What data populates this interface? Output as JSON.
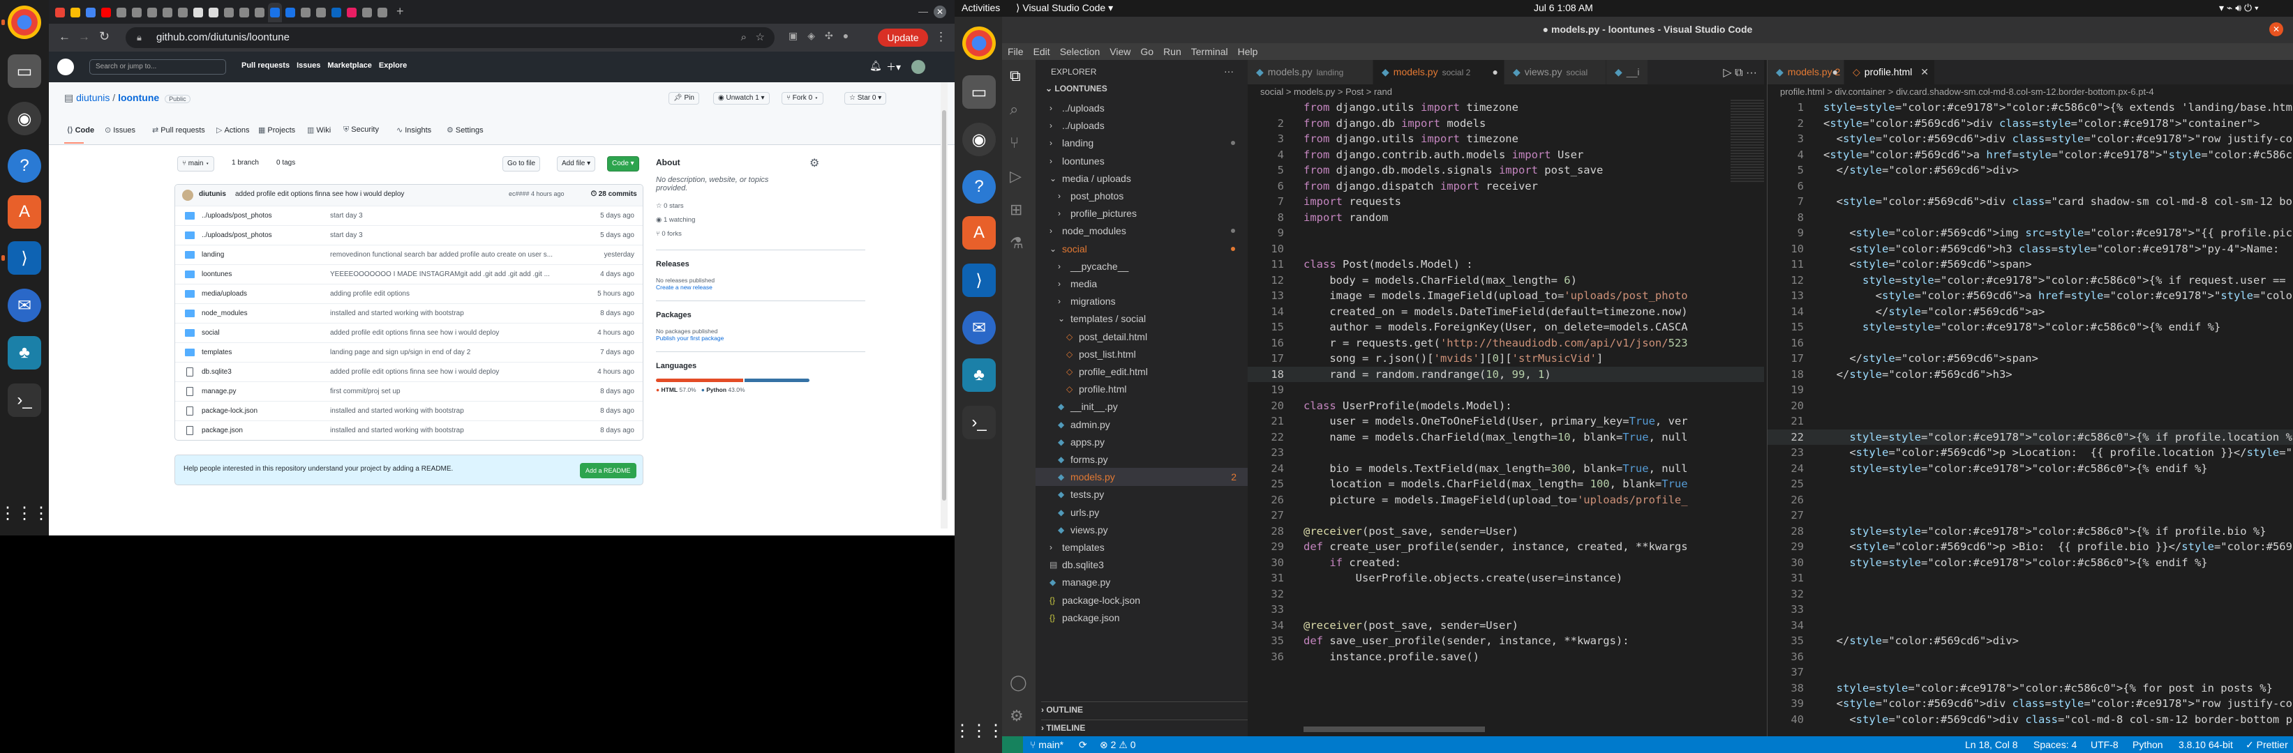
{
  "left": {
    "tabs_strip_icons": [
      "chrome-icon",
      "github-icon",
      "youtube-icon",
      "tab",
      "tab",
      "tab",
      "github-icon",
      "github-icon",
      "close-icon",
      "new-tab-icon"
    ],
    "url": "github.com/diutunis/loontune",
    "update_label": "Update",
    "gh": {
      "search_placeholder": "Search or jump to...",
      "nav": [
        "Pull requests",
        "Issues",
        "Marketplace",
        "Explore"
      ],
      "owner": "diutunis",
      "repo": "loontune",
      "visibility": "Public",
      "pin": "Pin",
      "unwatch": "Unwatch",
      "unwatch_count": "1",
      "fork": "Fork",
      "fork_count": "0",
      "star": "Star",
      "star_count": "0",
      "tabs": [
        "Code",
        "Issues",
        "Pull requests",
        "Actions",
        "Projects",
        "Wiki",
        "Security",
        "Insights",
        "Settings"
      ],
      "branch": "main",
      "branches": "1 branch",
      "tags": "0 tags",
      "goto_file": "Go to file",
      "add_file": "Add file",
      "code_btn": "Code",
      "commit_author": "diutunis",
      "commit_msg": "added profile edit options finna see how i would deploy",
      "commit_hash": "ec#### 4 hours ago",
      "commit_count": "28 commits",
      "files": [
        {
          "name": "../uploads/post_photos",
          "msg": "start day 3",
          "date": "5 days ago",
          "dir": true
        },
        {
          "name": "../uploads/post_photos",
          "msg": "start day 3",
          "date": "5 days ago",
          "dir": true
        },
        {
          "name": "landing",
          "msg": "removedinon functional search bar added profile auto create on user s...",
          "date": "yesterday",
          "dir": true
        },
        {
          "name": "loontunes",
          "msg": "YEEEEOOOOOOO I MADE INSTAGRAMgit add .git add .git add .git ...",
          "date": "4 days ago",
          "dir": true
        },
        {
          "name": "media/uploads",
          "msg": "adding profile edit options",
          "date": "5 hours ago",
          "dir": true
        },
        {
          "name": "node_modules",
          "msg": "installed and started working with bootstrap",
          "date": "8 days ago",
          "dir": true
        },
        {
          "name": "social",
          "msg": "added profile edit options finna see how i would deploy",
          "date": "4 hours ago",
          "dir": true
        },
        {
          "name": "templates",
          "msg": "landing page and sign up/sign in end of day 2",
          "date": "7 days ago",
          "dir": true
        },
        {
          "name": "db.sqlite3",
          "msg": "added profile edit options finna see how i would deploy",
          "date": "4 hours ago",
          "dir": false
        },
        {
          "name": "manage.py",
          "msg": "first commit/proj set up",
          "date": "8 days ago",
          "dir": false
        },
        {
          "name": "package-lock.json",
          "msg": "installed and started working with bootstrap",
          "date": "8 days ago",
          "dir": false
        },
        {
          "name": "package.json",
          "msg": "installed and started working with bootstrap",
          "date": "8 days ago",
          "dir": false
        }
      ],
      "readme_prompt": "Help people interested in this repository understand your project by adding a README.",
      "add_readme": "Add a README",
      "about_title": "About",
      "about_desc": "No description, website, or topics provided.",
      "stars": "0 stars",
      "watching": "1 watching",
      "forks": "0 forks",
      "releases_title": "Releases",
      "releases_desc": "No releases published",
      "releases_link": "Create a new release",
      "packages_title": "Packages",
      "packages_desc": "No packages published",
      "packages_link": "Publish your first package",
      "languages_title": "Languages",
      "lang1": "HTML",
      "lang1_pct": "57.0%",
      "lang2": "Python",
      "lang2_pct": "43.0%",
      "lang1_frac": 0.57,
      "lang1_color": "#e34c26",
      "lang2_color": "#3572A5"
    }
  },
  "right": {
    "activities": "Activities",
    "app_menu": "Visual Studio Code",
    "clock": "Jul 6  1:08 AM",
    "window_title": "● models.py - loontunes - Visual Studio Code",
    "menu": [
      "File",
      "Edit",
      "Selection",
      "View",
      "Go",
      "Run",
      "Terminal",
      "Help"
    ],
    "explorer_title": "EXPLORER",
    "root": "LOONTUNES",
    "tree": [
      {
        "label": "../uploads",
        "indent": 1,
        "kind": "folder"
      },
      {
        "label": "../uploads",
        "indent": 1,
        "kind": "folder"
      },
      {
        "label": "landing",
        "indent": 1,
        "kind": "folder",
        "dot": "grey"
      },
      {
        "label": "loontunes",
        "indent": 1,
        "kind": "folder"
      },
      {
        "label": "media / uploads",
        "indent": 1,
        "kind": "folder-open"
      },
      {
        "label": "post_photos",
        "indent": 2,
        "kind": "folder"
      },
      {
        "label": "profile_pictures",
        "indent": 2,
        "kind": "folder"
      },
      {
        "label": "node_modules",
        "indent": 1,
        "kind": "folder",
        "dot": "grey"
      },
      {
        "label": "social",
        "indent": 1,
        "kind": "folder-open",
        "color": "#e37933",
        "dot": "orange"
      },
      {
        "label": "__pycache__",
        "indent": 2,
        "kind": "folder"
      },
      {
        "label": "media",
        "indent": 2,
        "kind": "folder"
      },
      {
        "label": "migrations",
        "indent": 2,
        "kind": "folder"
      },
      {
        "label": "templates / social",
        "indent": 2,
        "kind": "folder-open"
      },
      {
        "label": "post_detail.html",
        "indent": 3,
        "kind": "html"
      },
      {
        "label": "post_list.html",
        "indent": 3,
        "kind": "html"
      },
      {
        "label": "profile_edit.html",
        "indent": 3,
        "kind": "html"
      },
      {
        "label": "profile.html",
        "indent": 3,
        "kind": "html"
      },
      {
        "label": "__init__.py",
        "indent": 2,
        "kind": "py"
      },
      {
        "label": "admin.py",
        "indent": 2,
        "kind": "py"
      },
      {
        "label": "apps.py",
        "indent": 2,
        "kind": "py"
      },
      {
        "label": "forms.py",
        "indent": 2,
        "kind": "py"
      },
      {
        "label": "models.py",
        "indent": 2,
        "kind": "py",
        "color": "#e37933",
        "badge": "2",
        "selected": true
      },
      {
        "label": "tests.py",
        "indent": 2,
        "kind": "py"
      },
      {
        "label": "urls.py",
        "indent": 2,
        "kind": "py"
      },
      {
        "label": "views.py",
        "indent": 2,
        "kind": "py"
      },
      {
        "label": "templates",
        "indent": 1,
        "kind": "folder"
      },
      {
        "label": "db.sqlite3",
        "indent": 1,
        "kind": "db"
      },
      {
        "label": "manage.py",
        "indent": 1,
        "kind": "py"
      },
      {
        "label": "package-lock.json",
        "indent": 1,
        "kind": "json"
      },
      {
        "label": "package.json",
        "indent": 1,
        "kind": "json"
      }
    ],
    "outline": "OUTLINE",
    "timeline": "TIMELINE",
    "editor1": {
      "tabs": [
        {
          "label": "models.py",
          "hint": "landing",
          "active": false
        },
        {
          "label": "models.py",
          "hint": "social 2",
          "active": true,
          "modified": true
        },
        {
          "label": "views.py",
          "hint": "social",
          "active": false
        },
        {
          "label": "__i",
          "hint": "",
          "active": false
        }
      ],
      "breadcrumb": "social  >  models.py  >  Post  >  rand",
      "lines": [
        {
          "n": "",
          "t": "from django.utils import timezone"
        },
        {
          "n": "2",
          "t": "from django.db import models"
        },
        {
          "n": "3",
          "t": "from django.utils import timezone"
        },
        {
          "n": "4",
          "t": "from django.contrib.auth.models import User"
        },
        {
          "n": "5",
          "t": "from django.db.models.signals import post_save"
        },
        {
          "n": "6",
          "t": "from django.dispatch import receiver"
        },
        {
          "n": "7",
          "t": "import requests"
        },
        {
          "n": "8",
          "t": "import random"
        },
        {
          "n": "9",
          "t": ""
        },
        {
          "n": "10",
          "t": ""
        },
        {
          "n": "11",
          "t": "class Post(models.Model) :"
        },
        {
          "n": "12",
          "t": "    body = models.CharField(max_length= 6)"
        },
        {
          "n": "13",
          "t": "    image = models.ImageField(upload_to='uploads/post_photo"
        },
        {
          "n": "14",
          "t": "    created_on = models.DateTimeField(default=timezone.now)"
        },
        {
          "n": "15",
          "t": "    author = models.ForeignKey(User, on_delete=models.CASCA"
        },
        {
          "n": "16",
          "t": "    r = requests.get('http://theaudiodb.com/api/v1/json/523"
        },
        {
          "n": "17",
          "t": "    song = r.json()['mvids'][0]['strMusicVid']"
        },
        {
          "n": "18",
          "t": "    rand = random.randrange(10, 99, 1)"
        },
        {
          "n": "19",
          "t": ""
        },
        {
          "n": "20",
          "t": "class UserProfile(models.Model):"
        },
        {
          "n": "21",
          "t": "    user = models.OneToOneField(User, primary_key=True, ver"
        },
        {
          "n": "22",
          "t": "    name = models.CharField(max_length=10, blank=True, null"
        },
        {
          "n": "23",
          "t": ""
        },
        {
          "n": "24",
          "t": "    bio = models.TextField(max_length=300, blank=True, null"
        },
        {
          "n": "25",
          "t": "    location = models.CharField(max_length= 100, blank=True"
        },
        {
          "n": "26",
          "t": "    picture = models.ImageField(upload_to='uploads/profile_"
        },
        {
          "n": "27",
          "t": ""
        },
        {
          "n": "28",
          "t": "@receiver(post_save, sender=User)"
        },
        {
          "n": "29",
          "t": "def create_user_profile(sender, instance, created, **kwargs"
        },
        {
          "n": "30",
          "t": "    if created:"
        },
        {
          "n": "31",
          "t": "        UserProfile.objects.create(user=instance)"
        },
        {
          "n": "32",
          "t": ""
        },
        {
          "n": "33",
          "t": ""
        },
        {
          "n": "34",
          "t": "@receiver(post_save, sender=User)"
        },
        {
          "n": "35",
          "t": "def save_user_profile(sender, instance, **kwargs):"
        },
        {
          "n": "36",
          "t": "    instance.profile.save()"
        }
      ]
    },
    "editor2": {
      "tabs": [
        {
          "label": "models.py 2",
          "active": false,
          "modified": true
        },
        {
          "label": "profile.html",
          "active": true
        }
      ],
      "breadcrumb": "profile.html  >  div.container  >  div.card.shadow-sm.col-md-8.col-sm-12.border-bottom.px-6.pt-4",
      "lines": [
        {
          "n": "1",
          "t": "{% extends 'landing/base.html' %} {% block content %}"
        },
        {
          "n": "2",
          "t": "<div class=\"container\">"
        },
        {
          "n": "3",
          "t": "  <div class=\"row justify-content-center mt-3\">"
        },
        {
          "n": "4",
          "t": "<a href=\"{% url 'post-list' %}\" class=\"btn btn-dark\">BACK<"
        },
        {
          "n": "5",
          "t": "  </div>"
        },
        {
          "n": "6",
          "t": ""
        },
        {
          "n": "7",
          "t": "  <div class=\"card shadow-sm col-md-8 col-sm-12 border-bott"
        },
        {
          "n": "8",
          "t": ""
        },
        {
          "n": "9",
          "t": "    <img src=\"{{ profile.picture.url }}\" class=\"circle\" wic"
        },
        {
          "n": "10",
          "t": "    <h3 class=\"py-4\">Name:  {{ profile.name }}"
        },
        {
          "n": "11",
          "t": "    <span>"
        },
        {
          "n": "12",
          "t": "      {% if request.user == user %}"
        },
        {
          "n": "13",
          "t": "        <a href=\"{% url 'profile-edit' profile.pk %}\" style"
        },
        {
          "n": "14",
          "t": "        </a>"
        },
        {
          "n": "15",
          "t": "      {% endif %}"
        },
        {
          "n": "16",
          "t": ""
        },
        {
          "n": "17",
          "t": "    </span>"
        },
        {
          "n": "18",
          "t": "  </h3>"
        },
        {
          "n": "19",
          "t": ""
        },
        {
          "n": "20",
          "t": ""
        },
        {
          "n": "21",
          "t": ""
        },
        {
          "n": "22",
          "t": "    {% if profile.location %}"
        },
        {
          "n": "23",
          "t": "    <p >Location:  {{ profile.location }}</p>"
        },
        {
          "n": "24",
          "t": "    {% endif %}"
        },
        {
          "n": "25",
          "t": ""
        },
        {
          "n": "26",
          "t": ""
        },
        {
          "n": "27",
          "t": ""
        },
        {
          "n": "28",
          "t": "    {% if profile.bio %}"
        },
        {
          "n": "29",
          "t": "    <p >Bio:  {{ profile.bio }}</p>"
        },
        {
          "n": "30",
          "t": "    {% endif %}"
        },
        {
          "n": "31",
          "t": ""
        },
        {
          "n": "32",
          "t": ""
        },
        {
          "n": "33",
          "t": ""
        },
        {
          "n": "34",
          "t": ""
        },
        {
          "n": "35",
          "t": "  </div>"
        },
        {
          "n": "36",
          "t": ""
        },
        {
          "n": "37",
          "t": ""
        },
        {
          "n": "38",
          "t": "  {% for post in posts %}"
        },
        {
          "n": "39",
          "t": "  <div class=\"row justify-content-center mt-6\">"
        },
        {
          "n": "40",
          "t": "    <div class=\"col-md-8 col-sm-12 border-bottom position-r"
        }
      ]
    },
    "status": {
      "branch": "main*",
      "sync": "⟳",
      "problems": "⊗ 2  ⚠ 0",
      "position": "Ln 18, Col 8",
      "spaces": "Spaces: 4",
      "encoding": "UTF-8",
      "lang": "Python",
      "interpreter": "3.8.10 64-bit",
      "prettier": "✓ Prettier"
    }
  }
}
